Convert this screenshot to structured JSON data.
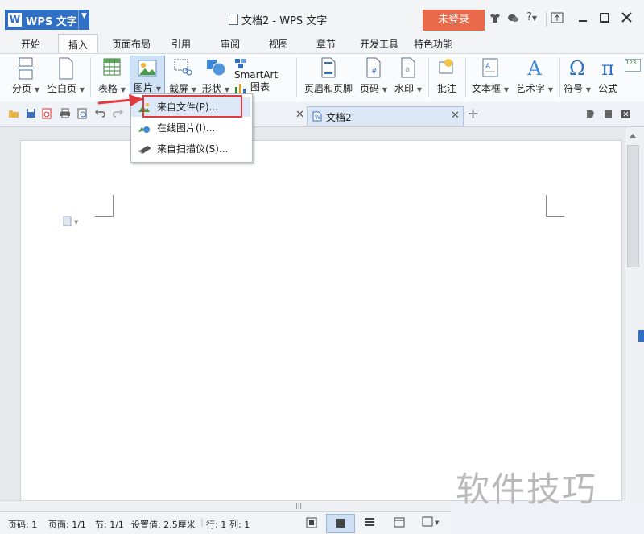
{
  "titlebar": {
    "app_name": "WPS 文字",
    "app_logo": "W",
    "window_title": "文档2 - WPS 文字",
    "login_label": "未登录",
    "help_label": "?"
  },
  "tabs": [
    "开始",
    "插入",
    "页面布局",
    "引用",
    "审阅",
    "视图",
    "章节",
    "开发工具",
    "特色功能"
  ],
  "ribbon": {
    "page_break": "分页",
    "blank_page": "空白页",
    "table": "表格",
    "picture": "图片",
    "screenshot": "截屏",
    "shapes": "形状",
    "smartart": "SmartArt",
    "chart": "图表",
    "header_footer": "页眉和页脚",
    "page_number": "页码",
    "watermark": "水印",
    "comment": "批注",
    "textbox": "文本框",
    "wordart": "艺术字",
    "symbol": "符号",
    "equation": "公式",
    "symbol_glyph": "Ω",
    "equation_glyph": "π",
    "wordart_glyph": "A"
  },
  "menu": {
    "from_file": "来自文件(P)...",
    "online_picture": "在线图片(I)...",
    "from_scanner": "来自扫描仪(S)..."
  },
  "doc_tab": {
    "name": "文档2"
  },
  "status": {
    "page_num": "页码: 1",
    "pages": "页面: 1/1",
    "section": "节: 1/1",
    "setting": "设置值: 2.5厘米",
    "row": "行: 1",
    "col": "列: 1"
  },
  "watermark_text": "软件技巧",
  "colors": {
    "accent": "#2f6fc4",
    "login": "#e96a4a",
    "highlight": "#e0393e"
  }
}
